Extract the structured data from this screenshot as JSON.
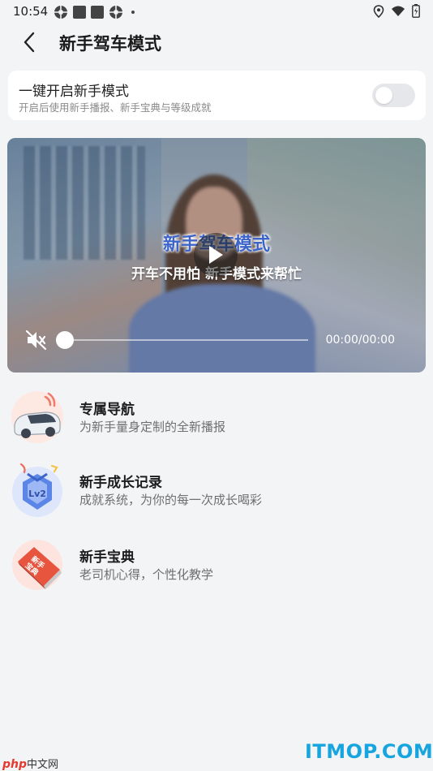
{
  "status_bar": {
    "time": "10:54",
    "left_icons": [
      "settings-gear-icon",
      "square-icon",
      "square-icon",
      "settings-gear-icon",
      "dot-icon"
    ],
    "right_icons": [
      "location-icon",
      "wifi-icon",
      "battery-icon"
    ]
  },
  "header": {
    "title": "新手驾车模式",
    "back_icon": "chevron-left-icon"
  },
  "novice_toggle": {
    "title": "一键开启新手模式",
    "subtitle": "开启后使用新手播报、新手宝典与等级成就",
    "enabled": false
  },
  "video": {
    "title_overlay": "新手驾车模式",
    "subtitle_overlay": "开车不用怕  新手模式来帮忙",
    "time": "00:00/00:00",
    "progress": 0,
    "muted": true
  },
  "features": [
    {
      "title": "专属导航",
      "description": "为新手量身定制的全新播报",
      "icon": "car-icon"
    },
    {
      "title": "新手成长记录",
      "description": "成就系统，为你的每一次成长喝彩",
      "icon": "level-badge-icon",
      "badge_text": "Lv2"
    },
    {
      "title": "新手宝典",
      "description": "老司机心得，个性化教学",
      "icon": "book-icon",
      "book_text": "新手宝典"
    }
  ],
  "watermarks": {
    "left_brand": "php",
    "left_text": "中文网",
    "right": "ITMOP.COM"
  },
  "colors": {
    "background": "#f3f4f6",
    "card": "#ffffff",
    "switch_off": "#e6e7ea",
    "video_title": "#3d64c8",
    "watermark_right": "#17a5e0"
  }
}
